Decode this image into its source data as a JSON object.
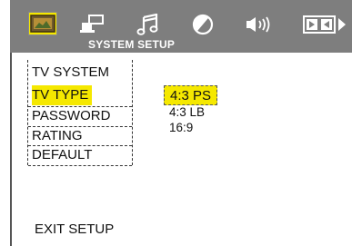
{
  "header": {
    "section_title": "SYSTEM SETUP",
    "tabs": [
      {
        "icon": "system-setup-icon",
        "selected": true
      },
      {
        "icon": "language-icon",
        "selected": false
      },
      {
        "icon": "audio-note-icon",
        "selected": false
      },
      {
        "icon": "video-display-icon",
        "selected": false
      },
      {
        "icon": "speaker-icon",
        "selected": false
      },
      {
        "icon": "dolby-digital-icon",
        "selected": false
      }
    ]
  },
  "menu": {
    "items": [
      {
        "label": "TV SYSTEM"
      },
      {
        "label": "TV TYPE",
        "highlighted": true
      },
      {
        "label": "PASSWORD"
      },
      {
        "label": "RATING"
      },
      {
        "label": "DEFAULT"
      }
    ],
    "exit_label": "EXIT SETUP"
  },
  "tv_type_options": [
    {
      "label": "4:3 PS",
      "selected": true
    },
    {
      "label": "4:3 LB"
    },
    {
      "label": "16:9"
    }
  ],
  "colors": {
    "header_bg": "#7e7e7e",
    "highlight": "#f5e800",
    "text": "#111111"
  }
}
